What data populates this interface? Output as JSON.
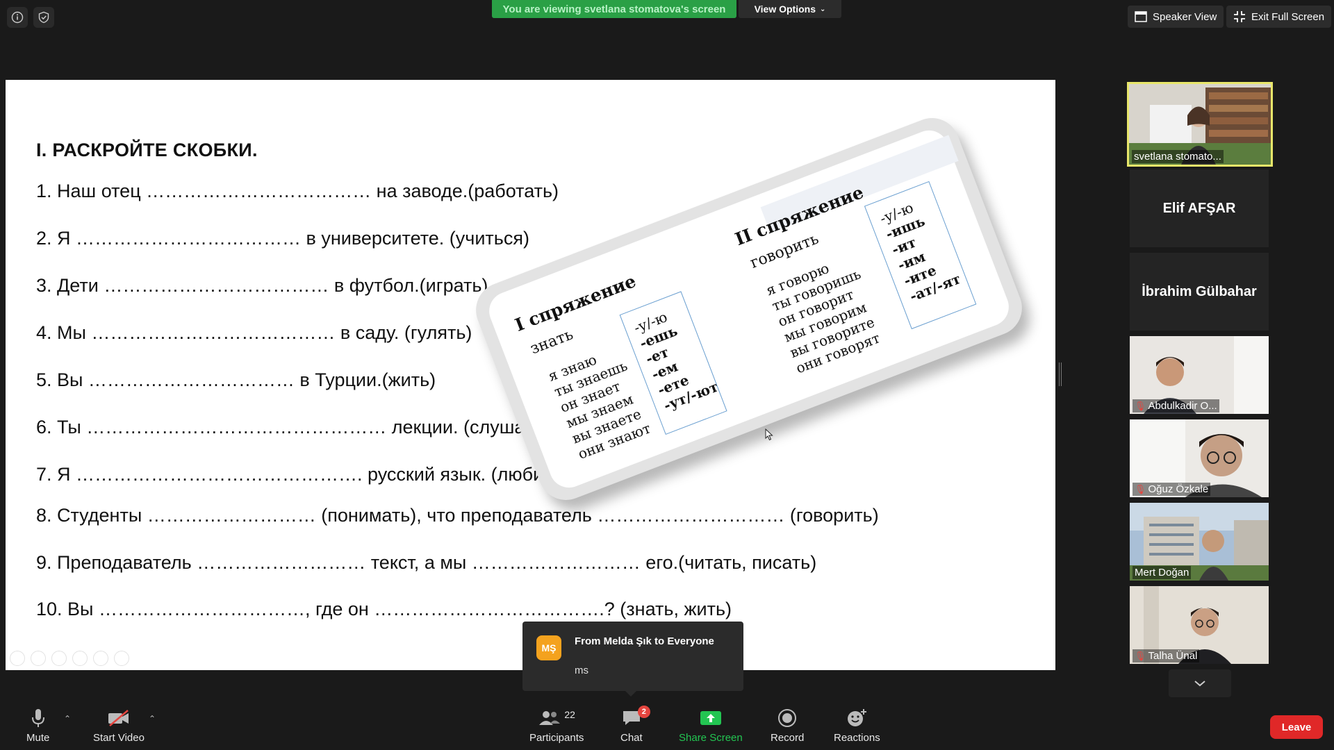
{
  "top_bar": {
    "viewing_banner": "You are viewing svetlana stomatova's screen",
    "view_options": "View Options",
    "speaker_view": "Speaker View",
    "exit_full_screen": "Exit Full Screen"
  },
  "slide": {
    "heading": "I. РАСКРОЙТЕ СКОБКИ.",
    "exercises": [
      "1. Наш отец ……………………………… на заводе.(работать)",
      "2. Я ……………………………… в университете. (учиться)",
      "3. Дети ……………………………… в футбол.(играть)",
      "4. Мы ………………………………… в саду. (гулять)",
      "5. Вы …………………………… в Турции.(жить)",
      "6. Ты ………………………………………… лекции. (слушать)",
      "7. Я ………………………………………. русский язык. (любить)",
      "8. Студенты ……………………… (понимать), что преподаватель ………………………… (говорить)",
      "9. Преподаватель ……………………… текст, а мы ……………………… его.(читать, писать)",
      "10. Вы ……………………………, где он ……………………………….? (знать, жить)"
    ],
    "conjugation_card": {
      "first": {
        "title": "I спряжение",
        "verb": "знать",
        "forms": [
          "я знаю",
          "ты знаешь",
          "он знает",
          "мы знаем",
          "вы знаете",
          "они знают"
        ],
        "endings": [
          "-у/-ю",
          "-ешь",
          "-ет",
          "-ем",
          "-ете",
          "-ут/-ют"
        ]
      },
      "second": {
        "title": "II спряжение",
        "verb": "говорить",
        "forms": [
          "я говорю",
          "ты говоришь",
          "он говорит",
          "мы говорим",
          "вы говорите",
          "они говорят"
        ],
        "endings": [
          "-у/-ю",
          "-ишь",
          "-ит",
          "-им",
          "-ите",
          "-ат/-ят"
        ]
      }
    }
  },
  "gallery": {
    "participants": [
      {
        "name": "svetlana stomato...",
        "video": true,
        "muted": false,
        "active": true
      },
      {
        "name": "Elif AFŞAR",
        "video": false,
        "muted": false
      },
      {
        "name": "İbrahim Gülbahar",
        "video": false,
        "muted": false
      },
      {
        "name": "Abdulkadir O...",
        "video": true,
        "muted": true
      },
      {
        "name": "Oğuz Özkale",
        "video": true,
        "muted": true
      },
      {
        "name": "Mert Doğan",
        "video": true,
        "muted": false
      },
      {
        "name": "Talha Ünal",
        "video": true,
        "muted": true
      }
    ]
  },
  "chat_popup": {
    "avatar_initials": "MŞ",
    "from": "From Melda Şık to Everyone",
    "message": "ms"
  },
  "toolbar": {
    "mute": "Mute",
    "start_video": "Start Video",
    "participants": "Participants",
    "participants_count": "22",
    "chat": "Chat",
    "chat_badge": "2",
    "share_screen": "Share Screen",
    "record": "Record",
    "reactions": "Reactions",
    "leave": "Leave"
  },
  "colors": {
    "banner_green": "#2aa046",
    "share_green": "#23c552",
    "leave_red": "#e02828",
    "active_speaker": "#e8e66a"
  }
}
